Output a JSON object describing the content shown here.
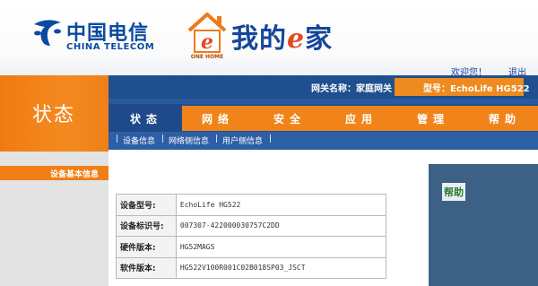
{
  "header": {
    "telecom_cn": "中国电信",
    "telecom_en": "CHINA TELECOM",
    "brand_prefix": "我的",
    "brand_e": "e",
    "brand_suffix": "家",
    "house_label": "ONE HOME",
    "welcome": "欢迎您！",
    "logout": "退出"
  },
  "info_bar": {
    "gateway_name": "网关名称：家庭网关",
    "model": "型号：EchoLife HG522"
  },
  "left": {
    "section_title": "状态",
    "panel_title": "设备基本信息"
  },
  "nav": {
    "tabs": [
      "状态",
      "网络",
      "安全",
      "应用",
      "管理",
      "帮助"
    ],
    "active": "状态"
  },
  "sub_nav": {
    "items": [
      "设备信息",
      "网络侧信息",
      "用户侧信息"
    ],
    "separator": "|"
  },
  "device_info": {
    "rows": [
      {
        "label": "设备型号:",
        "value": "EchoLife HG522"
      },
      {
        "label": "设备标识号:",
        "value": "007307-422000030757C2DD"
      },
      {
        "label": "硬件版本:",
        "value": "HG52MAGS"
      },
      {
        "label": "软件版本:",
        "value": "HG522V100R001C02B018SP03_JSCT"
      }
    ]
  },
  "help": {
    "title": "帮助"
  },
  "colors": {
    "orange": "#f0841a",
    "navy": "#1f4f8f",
    "brand_blue": "#0a4aa0"
  }
}
